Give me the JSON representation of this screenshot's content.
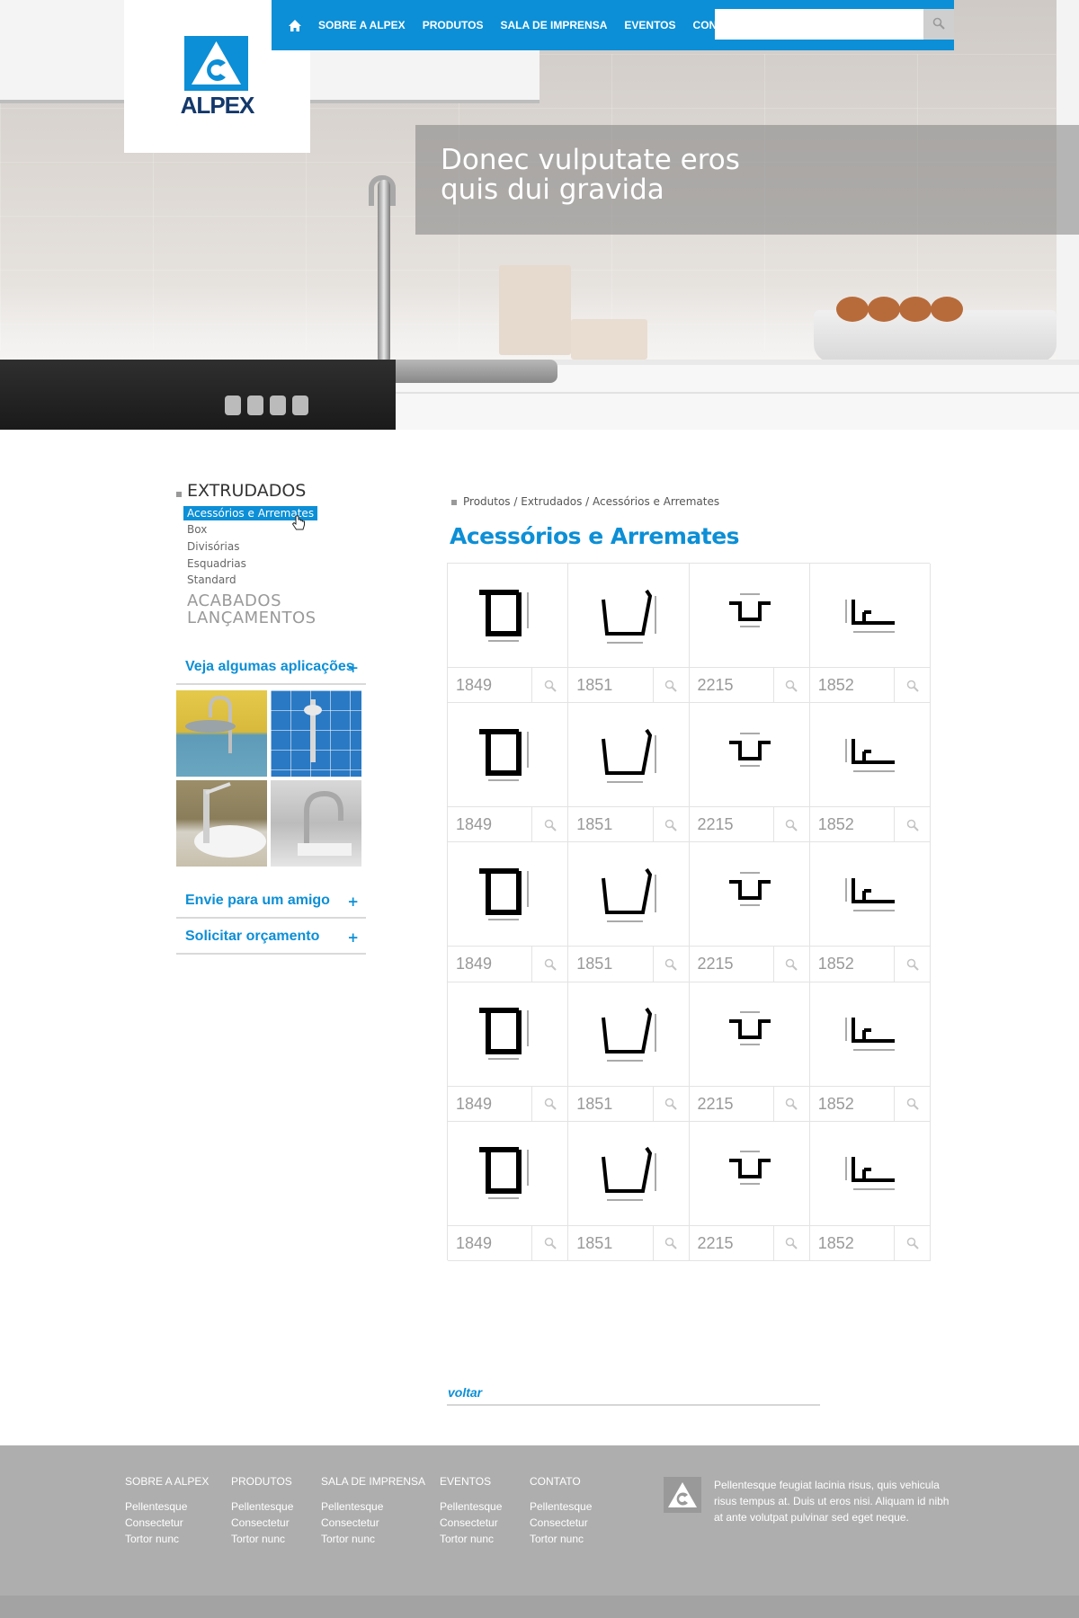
{
  "brand": {
    "name": "ALPEX",
    "accent_color": "#0c8fd6",
    "navy_color": "#13386b"
  },
  "nav": {
    "home_icon": "home-icon",
    "items": [
      {
        "label": "SOBRE A ALPEX"
      },
      {
        "label": "PRODUTOS"
      },
      {
        "label": "SALA DE IMPRENSA"
      },
      {
        "label": "EVENTOS"
      },
      {
        "label": "CONTATO"
      }
    ],
    "search": {
      "value": "",
      "placeholder": "",
      "icon": "search-icon"
    }
  },
  "hero": {
    "line1": "Donec vulputate eros",
    "line2": "quis dui gravida"
  },
  "sidebar": {
    "title": "EXTRUDADOS",
    "subitems": [
      {
        "label": "Acessórios e Arremates",
        "active": true
      },
      {
        "label": "Box"
      },
      {
        "label": "Divisórias"
      },
      {
        "label": "Esquadrias"
      },
      {
        "label": "Standard"
      }
    ],
    "categories": [
      "ACABADOS",
      "LANÇAMENTOS"
    ],
    "applications_label": "Veja algumas aplicações",
    "plus": "+",
    "send_friend_label": "Envie para um amigo",
    "quote_label": "Solicitar orçamento"
  },
  "breadcrumb": "Produtos / Extrudados / Acessórios e Arremates",
  "page_title": "Acessórios e Arremates",
  "products": {
    "rows": [
      [
        "1849",
        "1851",
        "2215",
        "1852"
      ],
      [
        "1849",
        "1851",
        "2215",
        "1852"
      ],
      [
        "1849",
        "1851",
        "2215",
        "1852"
      ],
      [
        "1849",
        "1851",
        "2215",
        "1852"
      ],
      [
        "1849",
        "1851",
        "2215",
        "1852"
      ]
    ],
    "zoom_icon": "magnifier-icon"
  },
  "back_link": "voltar",
  "footer": {
    "columns": [
      {
        "title": "SOBRE A ALPEX",
        "links": [
          "Pellentesque",
          "Consectetur",
          "Tortor nunc"
        ]
      },
      {
        "title": "PRODUTOS",
        "links": [
          "Pellentesque",
          "Consectetur",
          "Tortor nunc"
        ]
      },
      {
        "title": "SALA DE IMPRENSA",
        "links": [
          "Pellentesque",
          "Consectetur",
          "Tortor nunc"
        ]
      },
      {
        "title": "EVENTOS",
        "links": [
          "Pellentesque",
          "Consectetur",
          "Tortor nunc"
        ]
      },
      {
        "title": "CONTATO",
        "links": [
          "Pellentesque",
          "Consectetur",
          "Tortor nunc"
        ]
      }
    ],
    "text": "Pellentesque feugiat lacinia risus, quis vehicula risus tempus at. Duis ut eros nisi. Aliquam id nibh at ante volutpat pulvinar sed eget neque."
  }
}
